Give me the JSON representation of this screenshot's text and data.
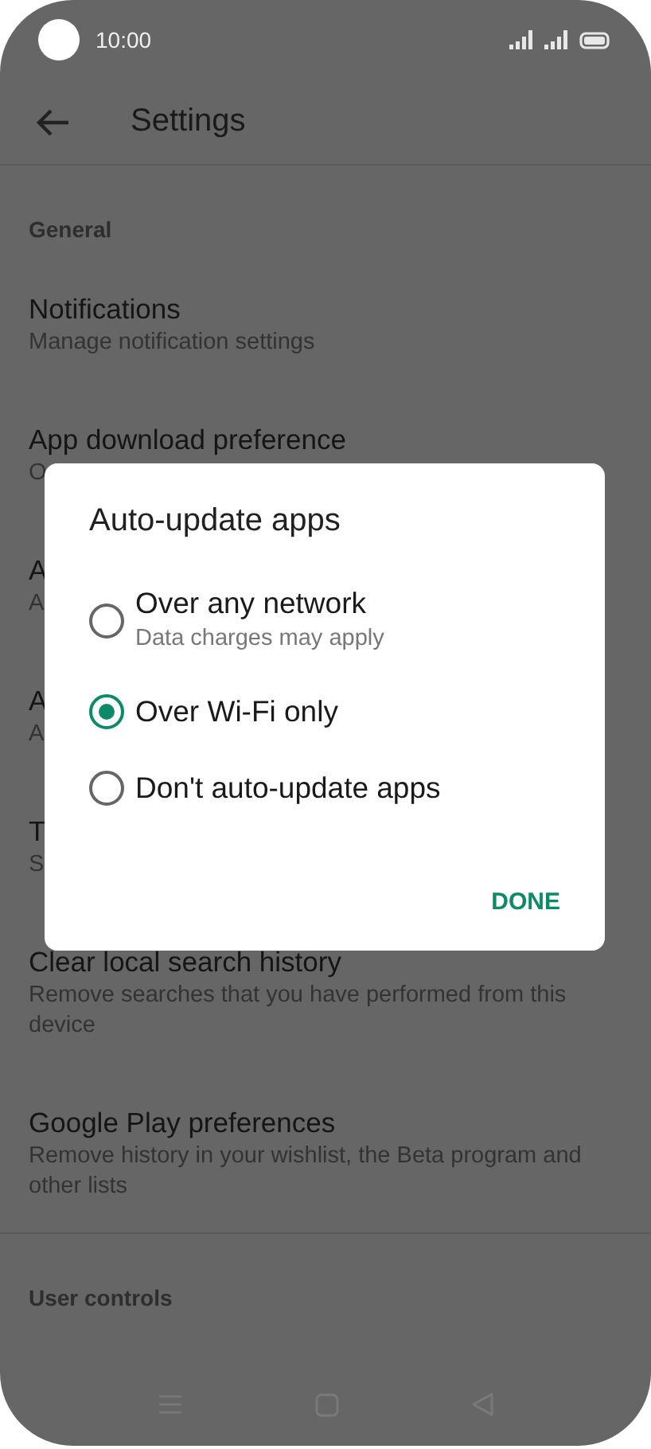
{
  "status_bar": {
    "time": "10:00"
  },
  "app_bar": {
    "title": "Settings"
  },
  "sections": [
    {
      "header": "General",
      "items": [
        {
          "title": "Notifications",
          "subtitle": "Manage notification settings"
        },
        {
          "title": "App download preference",
          "subtitle": "O"
        },
        {
          "title": "A",
          "subtitle": "A"
        },
        {
          "title": "A",
          "subtitle": "A"
        },
        {
          "title": "T",
          "subtitle": "S"
        },
        {
          "title": "Clear local search history",
          "subtitle": "Remove searches that you have performed from this device"
        },
        {
          "title": "Google Play preferences",
          "subtitle": "Remove history in your wishlist, the Beta program and other lists"
        }
      ]
    },
    {
      "header": "User controls"
    }
  ],
  "dialog": {
    "title": "Auto-update apps",
    "options": [
      {
        "label": "Over any network",
        "subtitle": "Data charges may apply",
        "selected": false
      },
      {
        "label": "Over Wi-Fi only",
        "selected": true
      },
      {
        "label": "Don't auto-update apps",
        "selected": false
      }
    ],
    "button": "DONE"
  }
}
